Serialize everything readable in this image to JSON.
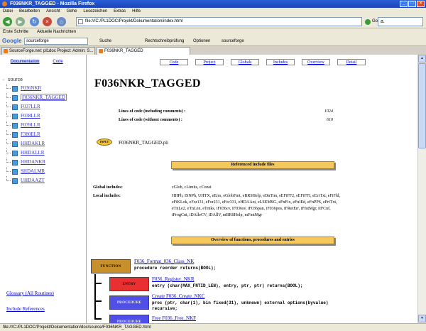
{
  "window": {
    "title": "F036NKR_TAGGED - Mozilla Firefox"
  },
  "menu": [
    "Datei",
    "Bearbeiten",
    "Ansicht",
    "Gehe",
    "Lesezeichen",
    "Extras",
    "Hilfe"
  ],
  "nav": {
    "url": "file:///C:/PL1DOC/Projekt/Dokumentation/index.html",
    "go_label": "Go",
    "search_value": "a."
  },
  "bookmarks": [
    "Erste Schritte",
    "Aktuelle Nachrichten"
  ],
  "google": {
    "logo": "Google",
    "search_value": "sourceforge",
    "items": [
      "Suche",
      "Rechtschreibprüfung",
      "Optionen",
      "sourceforge"
    ]
  },
  "tabs": [
    "SourceForge.net: pl1doc Project: Admin: S...",
    "F036NKR_TAGGED"
  ],
  "status": "file:///C:/PL1DOC/Projekt/Dokumentation/doc/source/F036NKR_TAGGED.html",
  "leftnav": {
    "tabs": [
      "Documentation",
      "Code"
    ],
    "root": "source",
    "items": [
      "F036NKR",
      "F036NKR_TAGGED",
      "F037LLR",
      "F038LLR",
      "F039LLR",
      "F380ELR",
      "HHDAKLR",
      "HHDALLR",
      "HHDANKR",
      "SHDALMR",
      "UHDAAZT"
    ],
    "selected_index": 1,
    "glossary": "Glossary (All Routines)",
    "includes": "Include References"
  },
  "topnav": [
    "Code",
    "Project",
    "Globals",
    "Includes",
    "Overview",
    "Detail"
  ],
  "page": {
    "title": "F036NKR_TAGGED",
    "loc_incl_label": "Lines of code (including comments) :",
    "loc_incl_value": "1024",
    "loc_excl_label": "Lines of code (without comments) :",
    "loc_excl_value": "610",
    "input_icon": "INPUT",
    "input_file": "F036NKR_TAGGED.pli",
    "referenced_includes": "Referenced include files",
    "global_label": "Global includes:",
    "global_value": "cGlob, cLimits, cConst",
    "local_label": "Local includes:",
    "local_value": "HHPh, ISNPh, UHTX, eErrs, eGlobFmt, eBRSHelp, eDnTim, eEFiFF2, eEFiFFI, eErrTxt, eFiFld, eFiKLok, eFor131, eFor231, eFor331, eHDAAzt, eLSEMSG, eFnFix, eFnIEd, eFnPPS, ePrtTxt, eTnLe2, eTnLen, eTrnks, iF036cv, iF036sv, iF036pan, iF036pos, iFRetErr, iFmtMgr, iIFCnf, iProgCnt, iDAlleCV, iDAllV, mBRSHelp, mFmtMgr",
    "overview": "Overview of functions, procedures and entries",
    "procs": [
      {
        "type": "FUNCTION",
        "name": "F036_Format_036_Class_NK",
        "sig": "procedure reorder returns(BOOL);"
      },
      {
        "type": "ENTRY",
        "name": "F036_Register_NKR",
        "sig": "entry (char(MAX_FNTID_LEN), entry, ptr, ptr) returns(BOOL);"
      },
      {
        "type": "PROCEDURE",
        "name_prefix": "Create",
        "name": "F036_Create_NKC",
        "sig": "proc (ptr, char(1), bin fixed(31), unknown) external options(byvalue)",
        "sig2": "recursive;"
      },
      {
        "type": "PROCEDURE",
        "name_prefix": "Free",
        "name": "F036_Free_NKF",
        "sig": ""
      }
    ]
  }
}
